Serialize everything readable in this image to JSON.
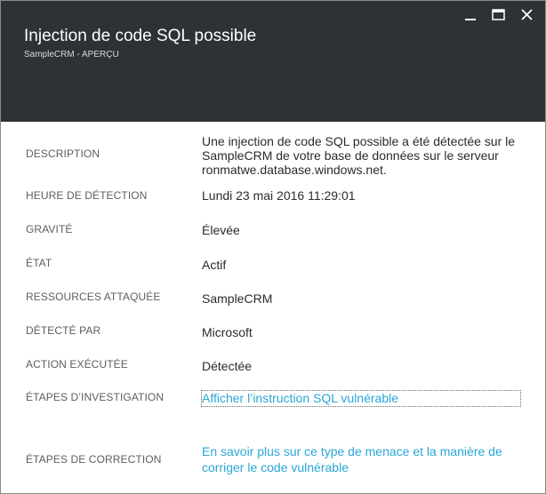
{
  "header": {
    "title": "Injection de code SQL possible",
    "subtitle": "SampleCRM - APERÇU",
    "minimize_icon": "minimize-icon",
    "maximize_icon": "maximize-icon",
    "close_icon": "close-icon"
  },
  "details": {
    "description": {
      "label": "DESCRIPTION",
      "value": "Une injection de code SQL possible a été détectée sur le SampleCRM de votre base de données sur le serveur ronmatwe.database.windows.net."
    },
    "detection_time": {
      "label": "HEURE DE DÉTECTION",
      "value": "Lundi 23 mai 2016 11:29:01"
    },
    "severity": {
      "label": "GRAVITÉ",
      "value": "Élevée"
    },
    "state": {
      "label": "ÉTAT",
      "value": "Actif"
    },
    "attacked_resources": {
      "label": "RESSOURCES ATTAQUÉE",
      "value": "SampleCRM"
    },
    "detected_by": {
      "label": "DÉTECTÉ PAR",
      "value": "Microsoft"
    },
    "action_taken": {
      "label": "ACTION EXÉCUTÉE",
      "value": "Détectée"
    },
    "investigation_steps": {
      "label": "ÉTAPES D’INVESTIGATION",
      "link": "Afficher l’instruction SQL vulnérable"
    },
    "remediation_steps": {
      "label": "ÉTAPES DE CORRECTION",
      "link": "En savoir plus sur ce type de menace et la manière de corriger le code vulnérable"
    }
  },
  "colors": {
    "header_bg": "#2d3237",
    "link": "#2aa6d6",
    "label": "#5a5f63",
    "value": "#2b2b2b"
  }
}
